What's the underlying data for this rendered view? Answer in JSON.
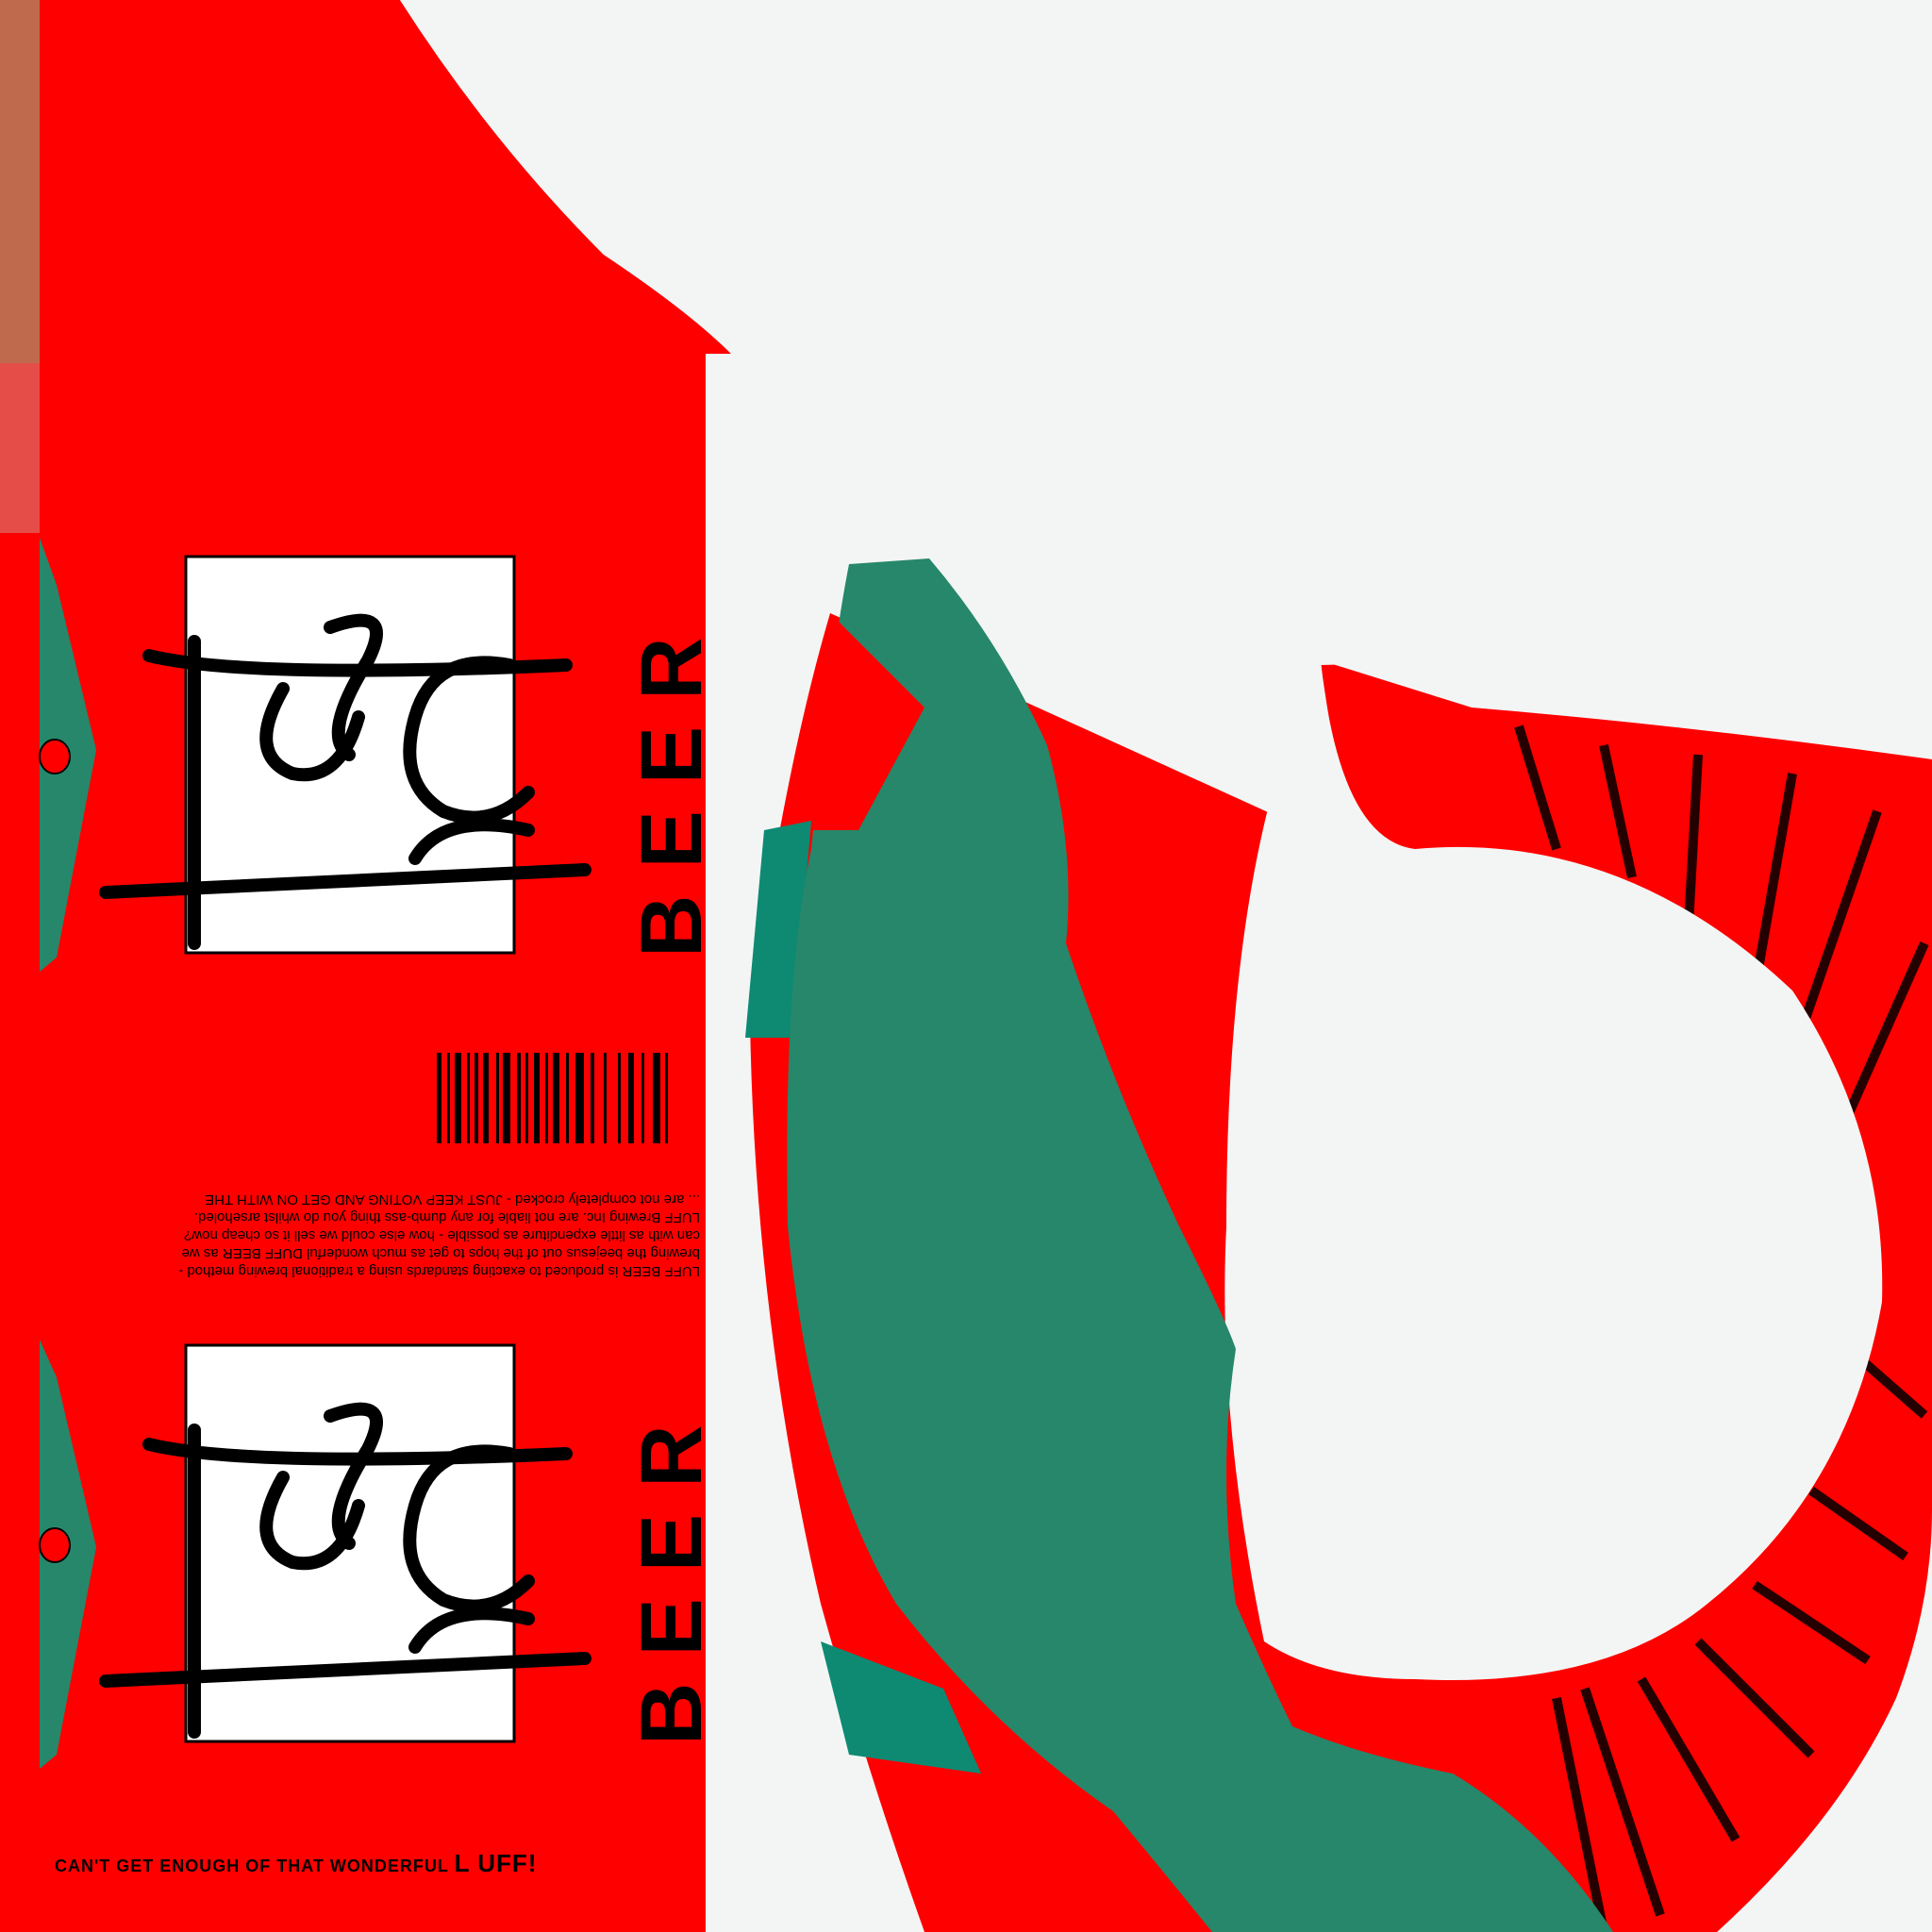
{
  "brand": {
    "logo_text": "Luff",
    "word": "BEER",
    "fine_print": [
      "LUFF BEER is produced to exacting standards using a traditional brewing method -",
      "brewing the beejesus out of the hops to get as much wonderful DUFF BEER as we",
      "can with as little expenditure as possible - how else could we sell it so cheap now?",
      "LUFF Brewing Inc. are not liable for any dumb-ass thing you do whilst arseholed.",
      "... are not completely crocked - JUST KEEP VOTING AND GET ON WITH THE"
    ],
    "slogan_prefix": "CAN'T GET ENOUGH OF THAT WONDERFUL ",
    "slogan_big": "L UFF!"
  },
  "colors": {
    "red": "#ff0000",
    "green": "#27876a",
    "teal": "#0e8a73",
    "background": "#f3f5f4",
    "black": "#000000",
    "white": "#ffffff"
  },
  "icons": {
    "pull_tab": "pull-tab-icon",
    "barcode": "barcode-icon"
  }
}
